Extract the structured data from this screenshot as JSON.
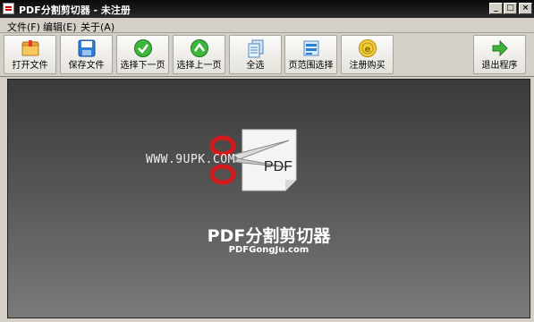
{
  "window": {
    "title": "PDF分割剪切器 - 未注册",
    "min_glyph": "_",
    "max_glyph": "□",
    "close_glyph": "×"
  },
  "menu": [
    "文件(F)",
    "编辑(E)",
    "关于(A)"
  ],
  "toolbar": {
    "open": "打开文件",
    "save": "保存文件",
    "next_page": "选择下一页",
    "prev_page": "选择上一页",
    "select_all": "全选",
    "page_range": "页范围选择",
    "register": "注册购买",
    "exit": "退出程序"
  },
  "main": {
    "watermark": "WWW.9UPK.COM",
    "logo_text": "PDF",
    "product_name": "PDF分割剪切器",
    "product_site": "PDFGongJu.com"
  }
}
